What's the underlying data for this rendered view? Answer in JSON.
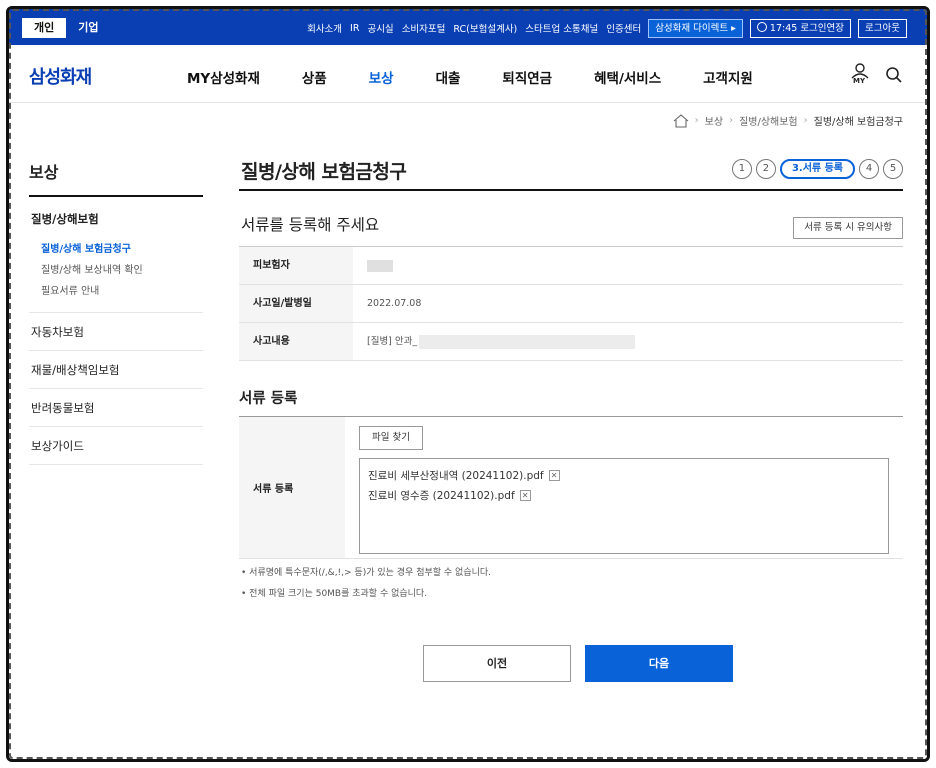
{
  "topbar": {
    "tabs": [
      {
        "label": "개인",
        "active": true
      },
      {
        "label": "기업",
        "active": false
      }
    ],
    "links": [
      "회사소개",
      "IR",
      "공시실",
      "소비자포털",
      "RC(보험설계사)",
      "스타트업 소통채널",
      "인증센터"
    ],
    "direct_label": "삼성화재 다이렉트 ▸",
    "session_label": "17:45 로그인연장",
    "logout_label": "로그아웃"
  },
  "gnb": {
    "logo": "삼성화재",
    "menu": [
      {
        "label": "MY삼성화재",
        "active": false
      },
      {
        "label": "상품",
        "active": false
      },
      {
        "label": "보상",
        "active": true
      },
      {
        "label": "대출",
        "active": false
      },
      {
        "label": "퇴직연금",
        "active": false
      },
      {
        "label": "혜택/서비스",
        "active": false
      },
      {
        "label": "고객지원",
        "active": false
      }
    ],
    "my_icon_label": "MY"
  },
  "breadcrumb": [
    "보상",
    "질병/상해보험",
    "질병/상해 보험금청구"
  ],
  "sidebar": {
    "title": "보상",
    "section": "질병/상해보험",
    "subitems": [
      {
        "label": "질병/상해 보험금청구",
        "active": true
      },
      {
        "label": "질병/상해 보상내역 확인",
        "active": false
      },
      {
        "label": "필요서류 안내",
        "active": false
      }
    ],
    "items": [
      "자동차보험",
      "재물/배상책임보험",
      "반려동물보험",
      "보상가이드"
    ]
  },
  "main": {
    "title": "질병/상해 보험금청구",
    "steps": [
      "1",
      "2",
      "3.서류 등록",
      "4",
      "5"
    ],
    "current_step": 2,
    "subtitle": "서류를 등록해 주세요",
    "notice_button": "서류 등록 시 유의사항",
    "info": [
      {
        "label": "피보험자",
        "value": ""
      },
      {
        "label": "사고일/발병일",
        "value": "2022.07.08"
      },
      {
        "label": "사고내용",
        "value": "[질병] 안과_"
      }
    ],
    "upload_title": "서류 등록",
    "upload_label": "서류 등록",
    "find_button": "파일 찾기",
    "files": [
      "진료비 세부산정내역 (20241102).pdf",
      "진료비 영수증 (20241102).pdf"
    ],
    "notes": [
      "• 서류명에 특수문자(/,&,!,> 등)가 있는 경우 첨부할 수 없습니다.",
      "• 전체 파일 크기는 50MB를 초과할 수 없습니다."
    ],
    "prev_button": "이전",
    "next_button": "다음"
  },
  "colors": {
    "brand": "#0a3fb4",
    "accent": "#0a62d8"
  }
}
